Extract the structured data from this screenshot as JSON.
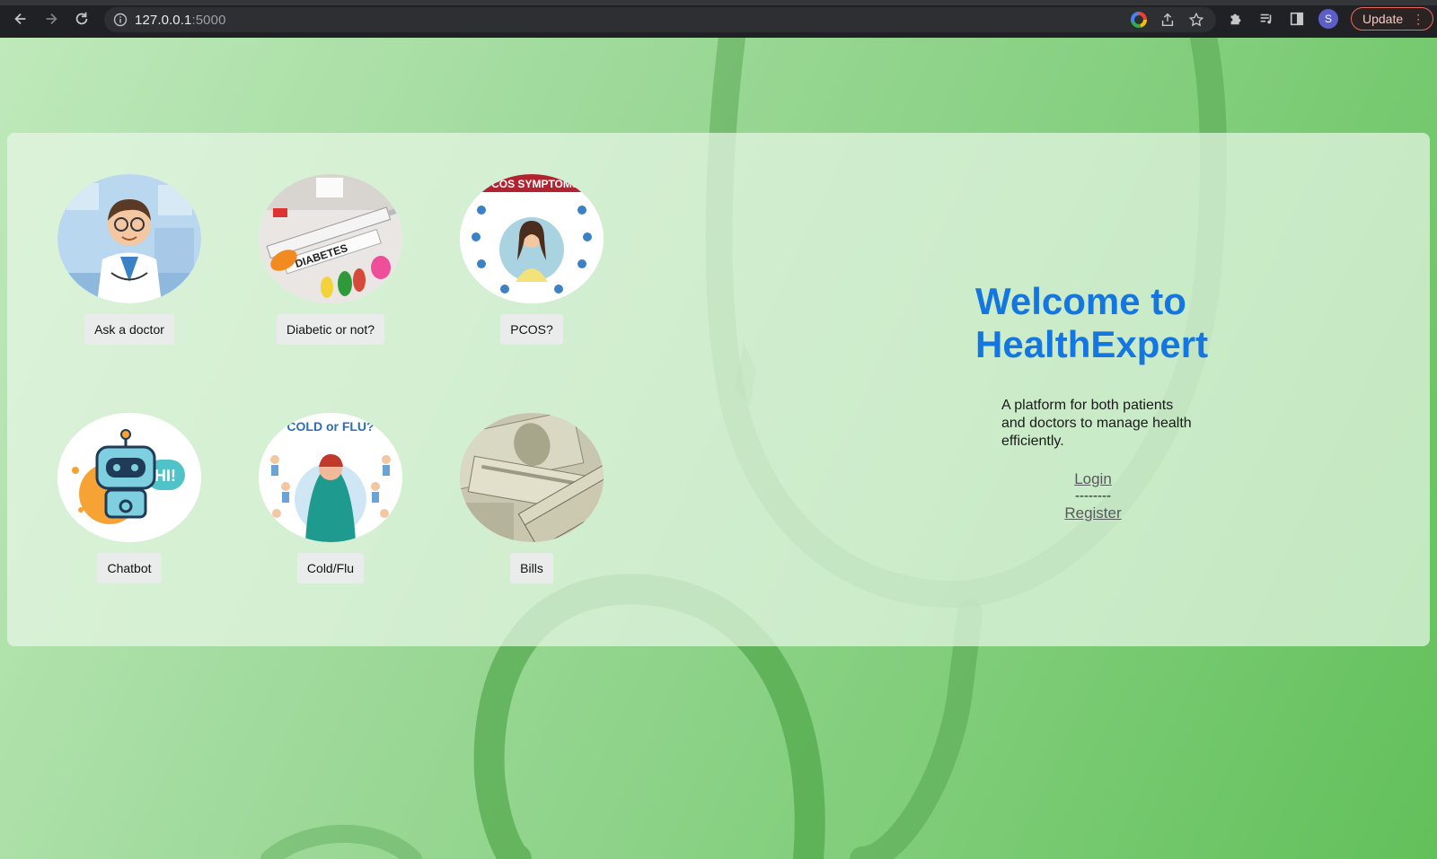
{
  "browser": {
    "url_host": "127.0.0.1",
    "url_port": ":5000",
    "profile_initial": "S",
    "update_label": "Update"
  },
  "tiles": [
    {
      "label": "Ask a doctor",
      "icon": "doctor-illustration"
    },
    {
      "label": "Diabetic or not?",
      "icon": "diabetes-syringe-photo"
    },
    {
      "label": "PCOS?",
      "icon": "pcos-symptoms-infographic",
      "caption": "PCOS SYMPTOMS"
    },
    {
      "label": "Chatbot",
      "icon": "robot-chatbot-illustration",
      "caption": "HI!"
    },
    {
      "label": "Cold/Flu",
      "icon": "cold-flu-illustration",
      "caption": "COLD or FLU?"
    },
    {
      "label": "Bills",
      "icon": "dollar-bills-photo"
    }
  ],
  "welcome": {
    "title": "Welcome to HealthExpert",
    "description": "A platform for both patients and doctors to manage health efficiently.",
    "login": "Login",
    "separator": "--------",
    "register": "Register"
  },
  "colors": {
    "title": "#1476e0",
    "panel": "#e8f6e6",
    "background": "#7fcd79"
  }
}
